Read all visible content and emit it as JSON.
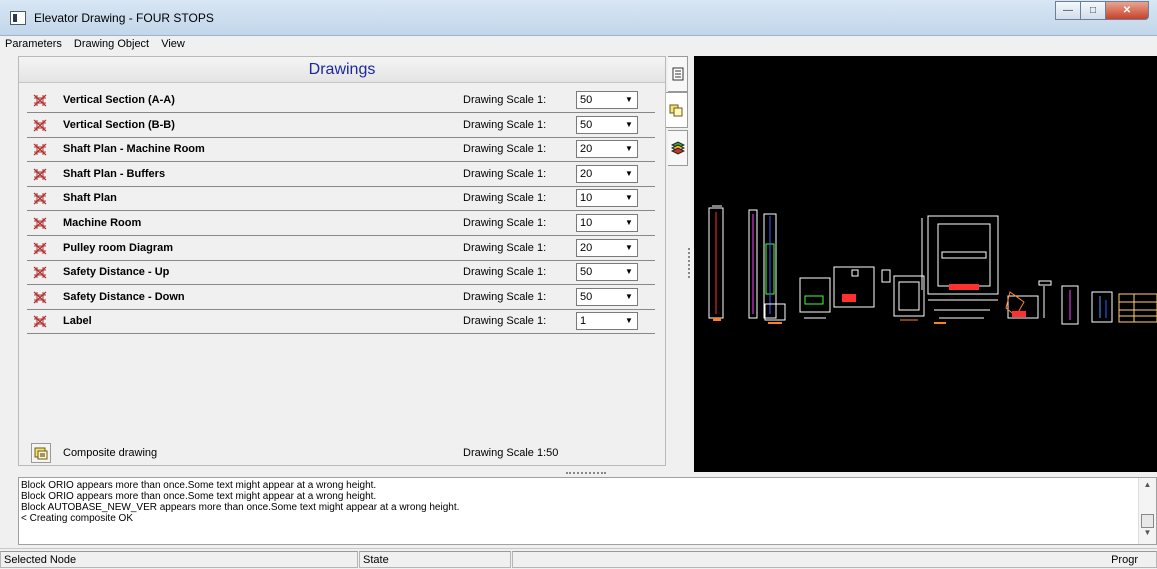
{
  "window": {
    "title": "Elevator Drawing - FOUR STOPS"
  },
  "menu": [
    "Parameters",
    "Drawing Object",
    "View"
  ],
  "panel": {
    "header": "Drawings"
  },
  "scale_label": "Drawing Scale 1:",
  "drawings": [
    {
      "name": "Vertical Section (A-A)",
      "scale": "50"
    },
    {
      "name": "Vertical Section (B-B)",
      "scale": "50"
    },
    {
      "name": "Shaft Plan - Machine Room",
      "scale": "20"
    },
    {
      "name": "Shaft Plan - Buffers",
      "scale": "20"
    },
    {
      "name": "Shaft Plan",
      "scale": "10"
    },
    {
      "name": "Machine Room",
      "scale": "10"
    },
    {
      "name": "Pulley room Diagram",
      "scale": "20"
    },
    {
      "name": "Safety Distance - Up",
      "scale": "50"
    },
    {
      "name": "Safety Distance - Down",
      "scale": "50"
    },
    {
      "name": "Label",
      "scale": "1"
    }
  ],
  "composite": {
    "label": "Composite drawing",
    "scale": "Drawing Scale 1:50"
  },
  "log": [
    "Block ORIO appears more than once.Some text might appear at a wrong height.",
    "Block ORIO appears more than once.Some text might appear at a wrong height.",
    "Block AUTOBASE_NEW_VER appears more than once.Some text might appear at a wrong height.",
    "< Creating composite OK"
  ],
  "status": {
    "selected_node": "Selected Node",
    "state": "State",
    "progress": "Progr"
  },
  "icons": {
    "drawing_row": "drawing-icon",
    "composite": "composite-icon",
    "tabs": [
      "document-icon",
      "composite-tab-icon",
      "layers-icon"
    ]
  }
}
